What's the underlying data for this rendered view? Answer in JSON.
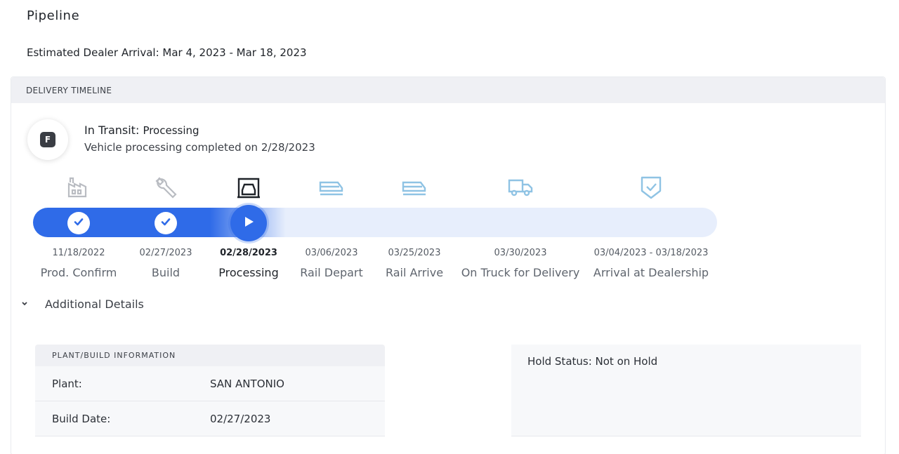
{
  "page": {
    "title": "Pipeline",
    "eta": "Estimated Dealer Arrival: Mar 4, 2023 - Mar 18, 2023"
  },
  "timeline": {
    "header": "DELIVERY TIMELINE",
    "badge_letter": "F",
    "status_label": "In Transit:",
    "status_value": "Processing",
    "status_detail": "Vehicle processing completed on 2/28/2023",
    "colors": {
      "accent": "#2f6be8",
      "track": "#e7eefc",
      "pending_icon": "#8fc3e4",
      "done_icon": "#b9bcc2"
    },
    "steps": [
      {
        "date": "11/18/2022",
        "label": "Prod. Confirm",
        "icon": "factory-icon",
        "state": "done"
      },
      {
        "date": "02/27/2023",
        "label": "Build",
        "icon": "wrench-icon",
        "state": "done"
      },
      {
        "date": "02/28/2023",
        "label": "Processing",
        "icon": "vehicle-processing-icon",
        "state": "current"
      },
      {
        "date": "03/06/2023",
        "label": "Rail Depart",
        "icon": "train-icon",
        "state": "pending"
      },
      {
        "date": "03/25/2023",
        "label": "Rail Arrive",
        "icon": "train-icon",
        "state": "pending"
      },
      {
        "date": "03/30/2023",
        "label": "On Truck for Delivery",
        "icon": "truck-icon",
        "state": "pending"
      },
      {
        "date": "03/04/2023 - 03/18/2023",
        "label": "Arrival at Dealership",
        "icon": "shield-check-icon",
        "state": "pending"
      }
    ]
  },
  "details": {
    "toggle_label": "Additional Details",
    "plant": {
      "header": "PLANT/BUILD INFORMATION",
      "rows": [
        {
          "key": "Plant:",
          "value": "SAN ANTONIO"
        },
        {
          "key": "Build Date:",
          "value": "02/27/2023"
        }
      ]
    },
    "hold_status": "Hold Status: Not on Hold"
  }
}
